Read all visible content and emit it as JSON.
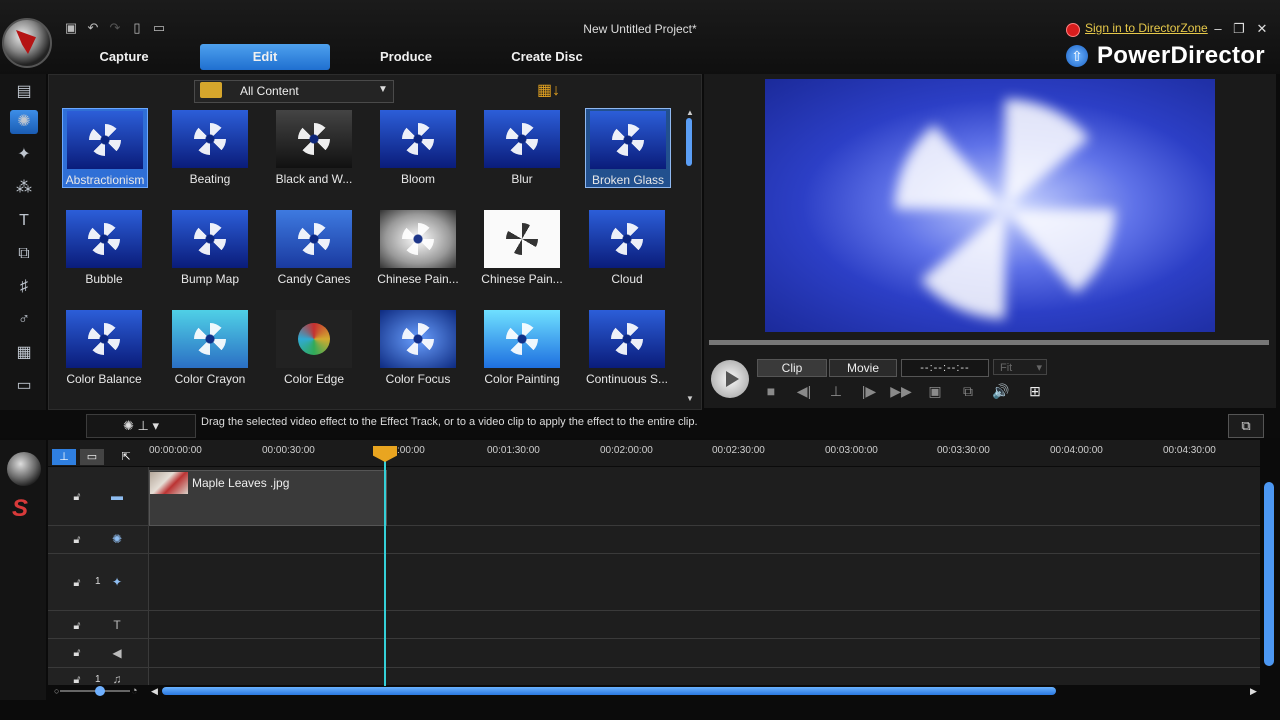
{
  "window": {
    "title": "New Untitled Project*",
    "signin": "Sign in to DirectorZone",
    "brand": "PowerDirector"
  },
  "nav": {
    "tabs": [
      "Capture",
      "Edit",
      "Produce",
      "Create Disc"
    ]
  },
  "library": {
    "filter": "All Content",
    "effects": [
      {
        "label": "Abstractionism",
        "selected": true
      },
      {
        "label": "Beating"
      },
      {
        "label": "Black and W..."
      },
      {
        "label": "Bloom"
      },
      {
        "label": "Blur"
      },
      {
        "label": "Broken Glass",
        "hovered": true
      },
      {
        "label": "Bubble"
      },
      {
        "label": "Bump Map"
      },
      {
        "label": "Candy Canes"
      },
      {
        "label": "Chinese Pain..."
      },
      {
        "label": "Chinese Pain..."
      },
      {
        "label": "Cloud"
      },
      {
        "label": "Color Balance"
      },
      {
        "label": "Color Crayon"
      },
      {
        "label": "Color Edge"
      },
      {
        "label": "Color Focus"
      },
      {
        "label": "Color Painting"
      },
      {
        "label": "Continuous S..."
      }
    ]
  },
  "preview": {
    "tab_clip": "Clip",
    "tab_movie": "Movie",
    "timecode": "--:--:--:--",
    "fit": "Fit"
  },
  "status": {
    "hint": "Drag the selected video effect to the Effect Track, or to a video clip to apply the effect to the entire clip."
  },
  "timeline": {
    "ruler": [
      "00:00:00:00",
      "00:00:30:00",
      "00:01:30:00",
      "00:02:00:00",
      "00:02:30:00",
      "00:03:00:00",
      "00:03:30:00",
      "00:04:00:00",
      "00:04:30:00"
    ],
    "playhead_time": ":00:00",
    "clip": {
      "label": "Maple Leaves .jpg"
    },
    "track_numbers": [
      "1",
      "1"
    ]
  },
  "colors": {
    "accent": "#2f7fe0",
    "playhead": "#34d0d8",
    "signin": "#e6c84a"
  }
}
